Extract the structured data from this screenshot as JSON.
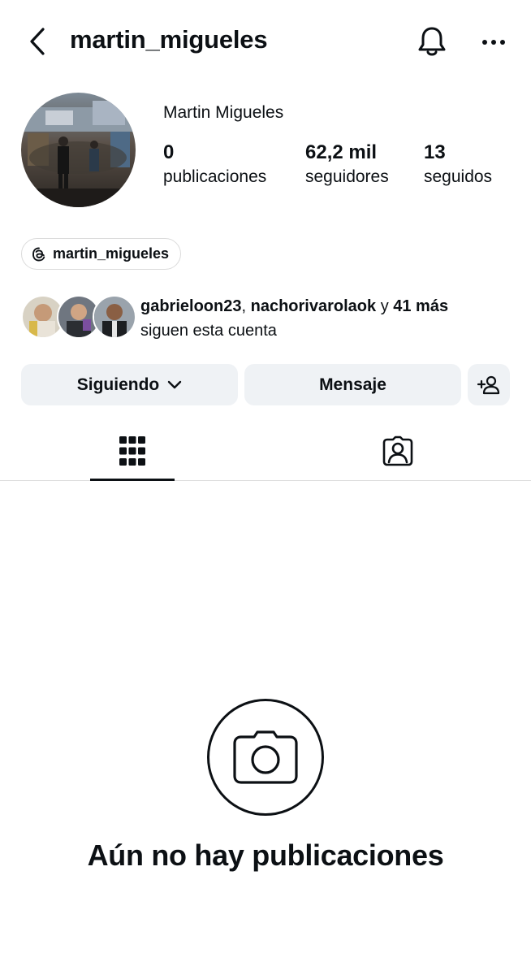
{
  "header": {
    "username": "martin_migueles",
    "icons": {
      "back": "chevron-left-icon",
      "notifications": "bell-icon",
      "more": "more-horizontal-icon"
    }
  },
  "profile": {
    "display_name": "Martin Migueles",
    "stats": [
      {
        "count": "0",
        "label": "publicaciones"
      },
      {
        "count": "62,2 mil",
        "label": "seguidores"
      },
      {
        "count": "13",
        "label": "seguidos"
      }
    ],
    "threads_handle": "martin_migueles"
  },
  "followed_by": {
    "users": [
      "gabrieloon23",
      "nachorivarolaok"
    ],
    "connector": "y",
    "others": "41 más",
    "suffix": "siguen esta cuenta"
  },
  "actions": {
    "following_label": "Siguiendo",
    "message_label": "Mensaje",
    "add_user_icon": "add-person-icon"
  },
  "tabs": [
    {
      "name": "posts",
      "icon": "grid-icon",
      "active": true
    },
    {
      "name": "tagged",
      "icon": "tagged-user-icon",
      "active": false
    }
  ],
  "empty_state": {
    "icon": "camera-icon",
    "title": "Aún no hay publicaciones"
  },
  "colors": {
    "text": "#0c1014",
    "button_bg": "#eff2f5",
    "divider": "#dbdbdb",
    "background": "#ffffff"
  }
}
